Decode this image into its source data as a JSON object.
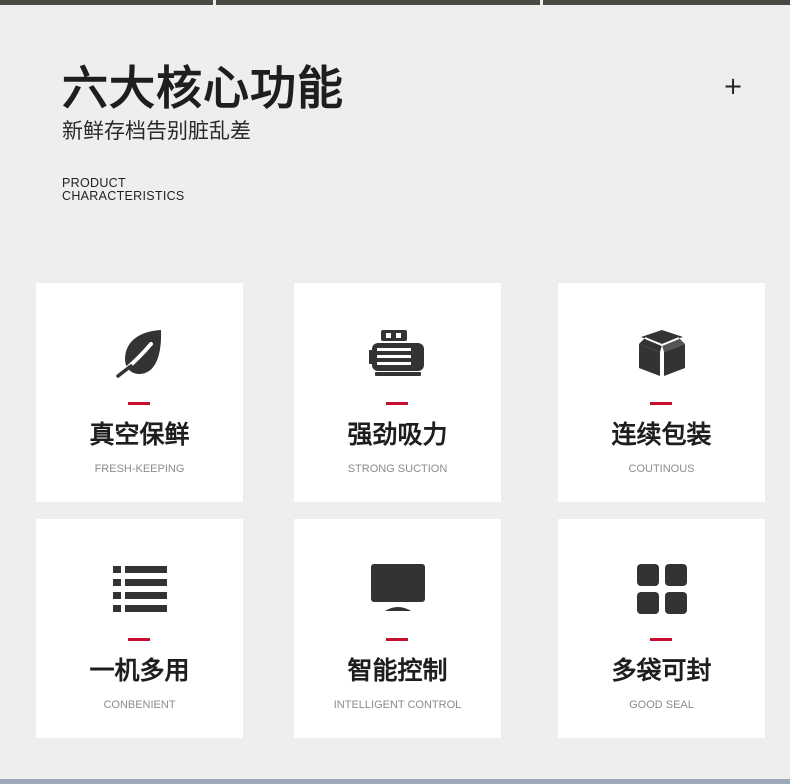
{
  "header": {
    "title": "六大核心功能",
    "subtitle": "新鲜存档告别脏乱差",
    "eng_line1": "PRODUCT",
    "eng_line2": "CHARACTERISTICS",
    "expand_symbol": "+"
  },
  "features": [
    {
      "cn": "真空保鲜",
      "en": "FRESH-KEEPING",
      "icon": "leaf-icon"
    },
    {
      "cn": "强劲吸力",
      "en": "STRONG SUCTION",
      "icon": "motor-icon"
    },
    {
      "cn": "连续包装",
      "en": "COUTINOUS",
      "icon": "box-icon"
    },
    {
      "cn": "一机多用",
      "en": "CONBENIENT",
      "icon": "list-icon"
    },
    {
      "cn": "智能控制",
      "en": "INTELLIGENT CONTROL",
      "icon": "monitor-icon"
    },
    {
      "cn": "多袋可封",
      "en": "GOOD SEAL",
      "icon": "grid-icon"
    }
  ],
  "colors": {
    "accent": "#c8102e",
    "icon": "#333333",
    "background": "#eeeeee",
    "card": "#ffffff"
  }
}
